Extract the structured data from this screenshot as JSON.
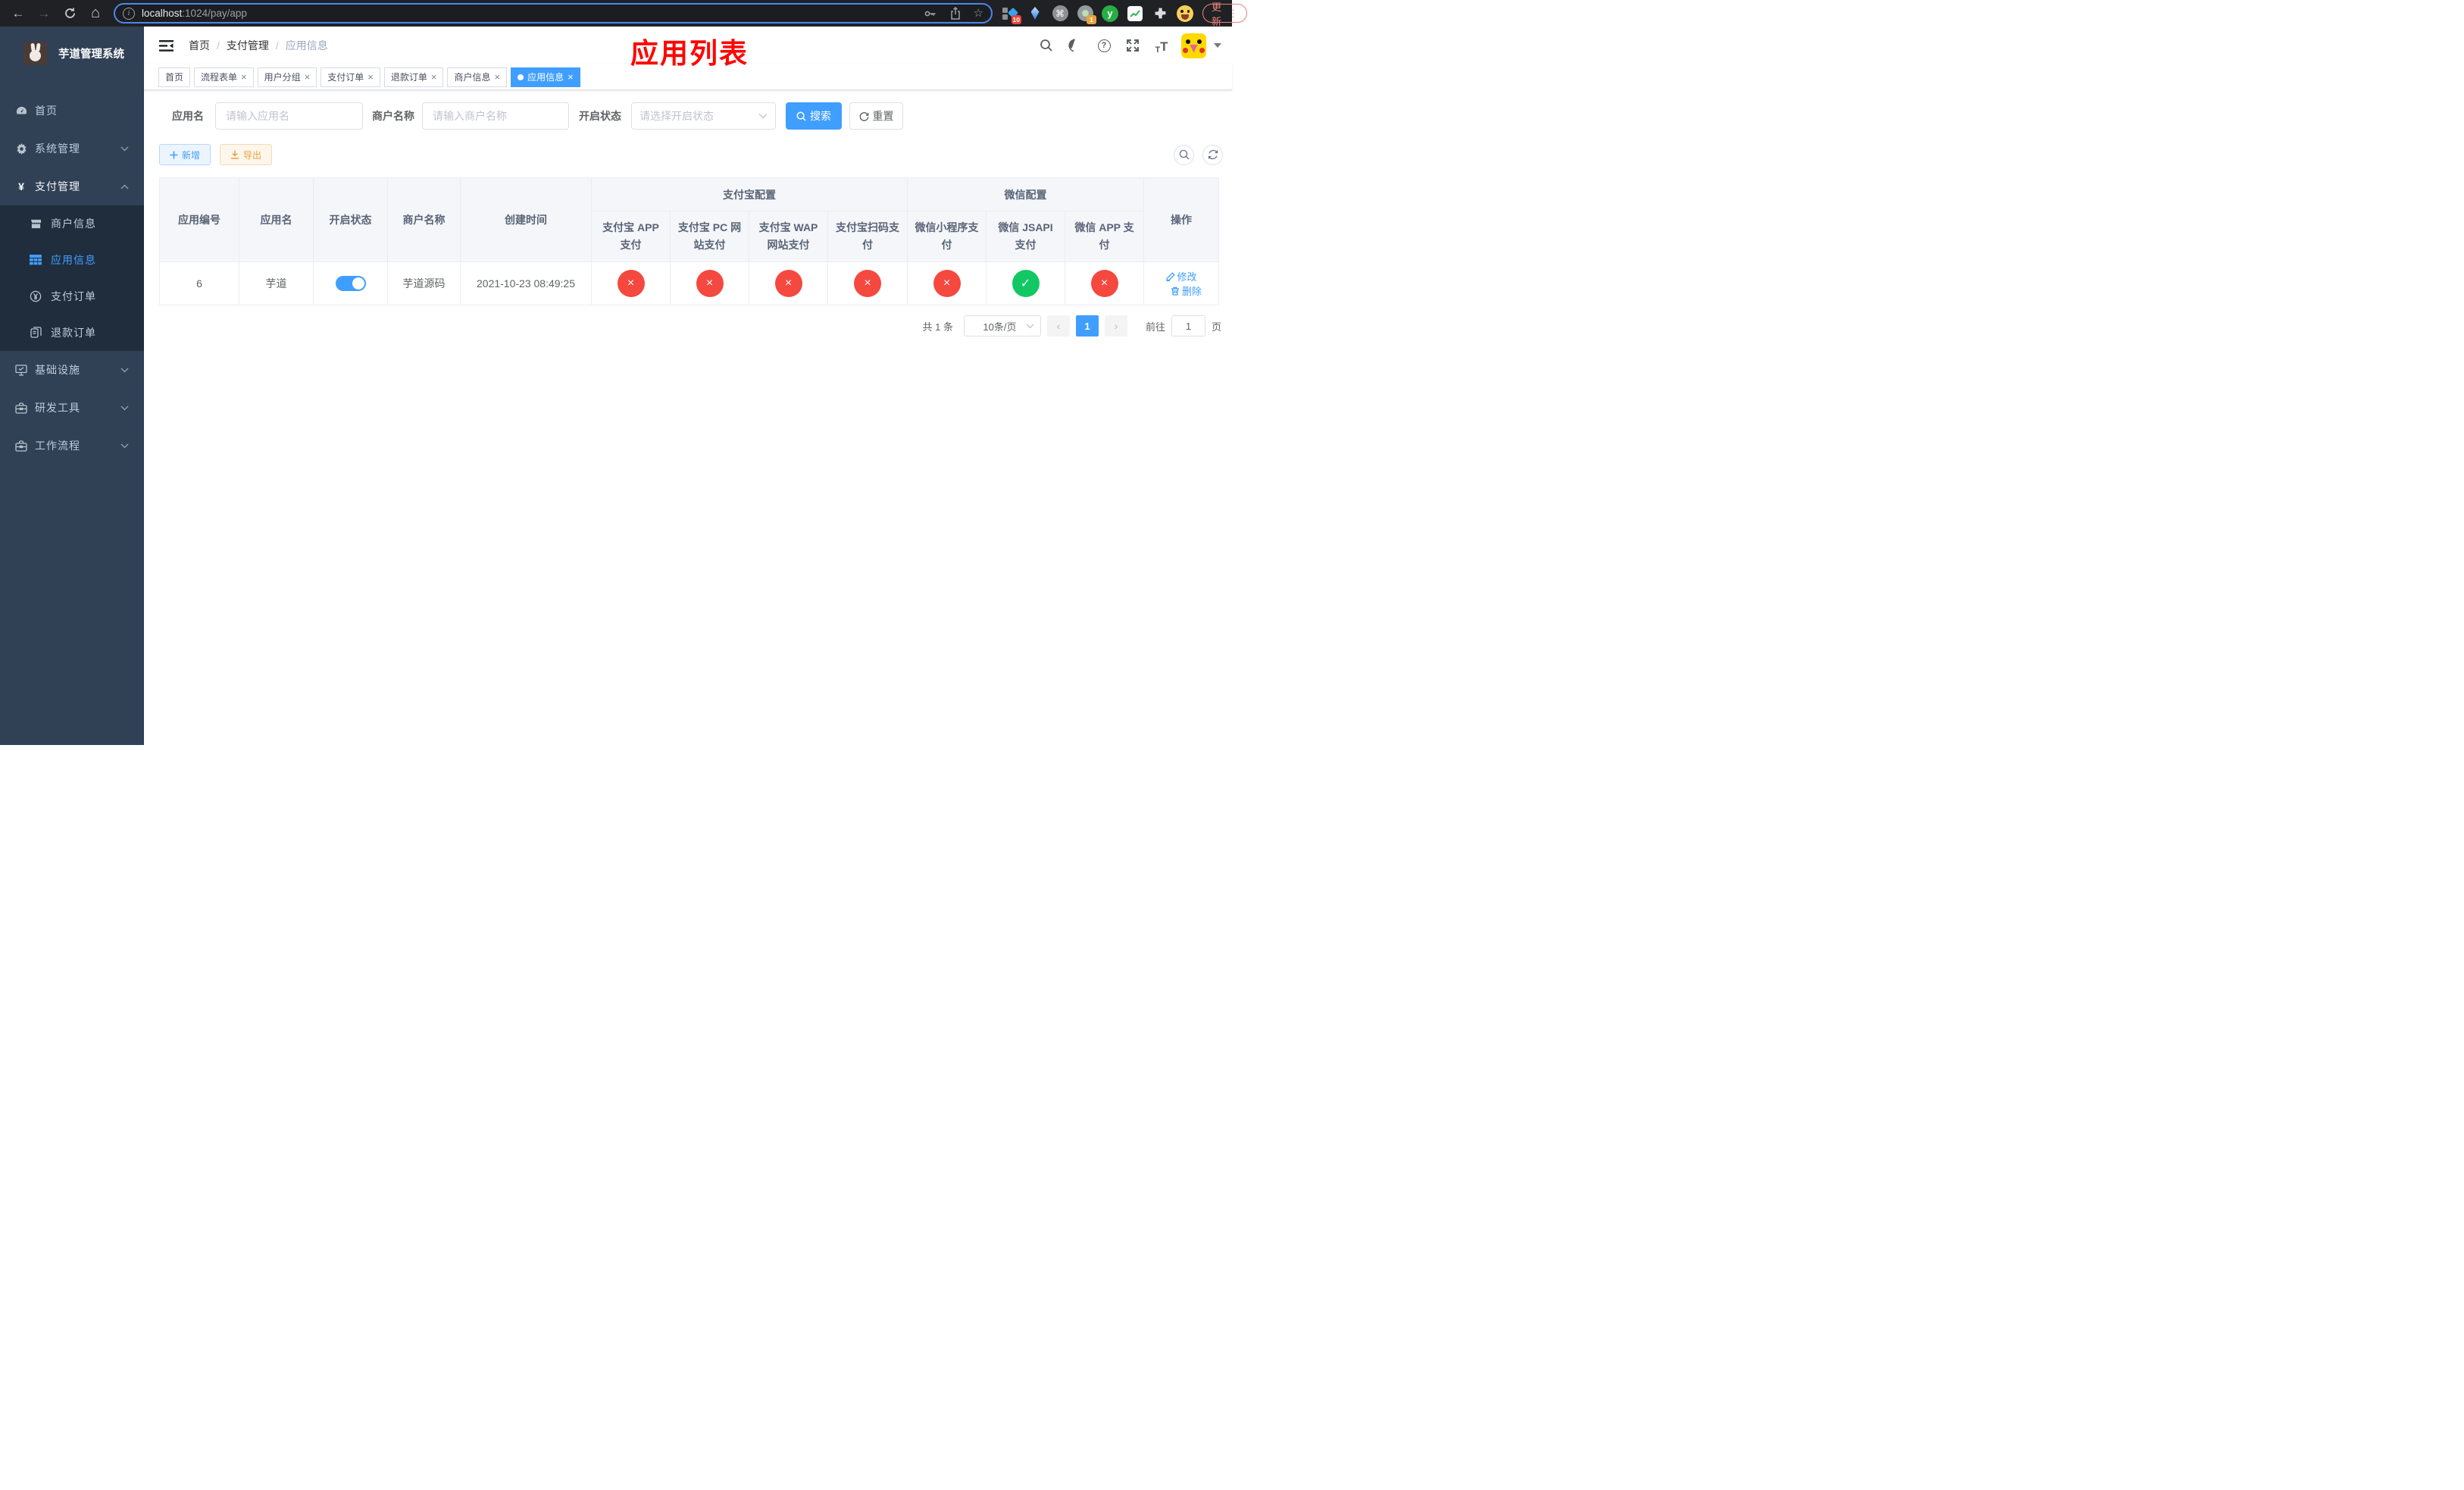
{
  "browser": {
    "url_host": "localhost",
    "url_rest": ":1024/pay/app",
    "update_label": "更新",
    "ext_badge_10": "10",
    "ext_badge_1": "1",
    "ext_y_label": "y"
  },
  "icons": {
    "back": "←",
    "forward": "→",
    "home": "⌂",
    "star": "☆",
    "cmd": "⌘",
    "info": "i",
    "question": "?",
    "close": "×",
    "slash": "/",
    "dots_v": "⋮",
    "prev": "‹",
    "next": "›",
    "plus": "＋",
    "font_small": "T",
    "font_big": "T",
    "yen": "¥"
  },
  "sidebar": {
    "title": "芋道管理系统",
    "menu": [
      {
        "label": "首页"
      },
      {
        "label": "系统管理"
      },
      {
        "label": "支付管理"
      },
      {
        "label": "商户信息"
      },
      {
        "label": "应用信息"
      },
      {
        "label": "支付订单"
      },
      {
        "label": "退款订单"
      },
      {
        "label": "基础设施"
      },
      {
        "label": "研发工具"
      },
      {
        "label": "工作流程"
      }
    ]
  },
  "header": {
    "breadcrumb": [
      "首页",
      "支付管理",
      "应用信息"
    ],
    "annotation": "应用列表"
  },
  "tabs": [
    {
      "label": "首页"
    },
    {
      "label": "流程表单"
    },
    {
      "label": "用户分组"
    },
    {
      "label": "支付订单"
    },
    {
      "label": "退款订单"
    },
    {
      "label": "商户信息"
    },
    {
      "label": "应用信息"
    }
  ],
  "filters": {
    "app_name_label": "应用名",
    "app_name_placeholder": "请输入应用名",
    "merchant_label": "商户名称",
    "merchant_placeholder": "请输入商户名称",
    "status_label": "开启状态",
    "status_placeholder": "请选择开启状态",
    "search_label": "搜索",
    "reset_label": "重置"
  },
  "toolbar": {
    "add_label": "新增",
    "export_label": "导出"
  },
  "table": {
    "main_columns": [
      "应用编号",
      "应用名",
      "开启状态",
      "商户名称",
      "创建时间"
    ],
    "groups": [
      {
        "label": "支付宝配置",
        "children": [
          "支付宝 APP 支付",
          "支付宝 PC 网站支付",
          "支付宝 WAP 网站支付",
          "支付宝扫码支付"
        ]
      },
      {
        "label": "微信配置",
        "children": [
          "微信小程序支付",
          "微信 JSAPI 支付",
          "微信 APP 支付"
        ]
      }
    ],
    "ops_column": "操作",
    "row": {
      "id": "6",
      "name": "芋道",
      "enabled": true,
      "merchant": "芋道源码",
      "created": "2021-10-23 08:49:25",
      "channels": [
        false,
        false,
        false,
        false,
        false,
        true,
        false
      ],
      "edit_label": "修改",
      "delete_label": "删除"
    }
  },
  "pagination": {
    "total_text": "共 1 条",
    "page_size": "10条/页",
    "current_page": "1",
    "goto_label": "前往",
    "goto_value": "1",
    "page_unit": "页"
  },
  "colors": {
    "accent": "#409eff",
    "success": "#12c863",
    "danger": "#f5483f",
    "warning": "#e6a23c"
  }
}
